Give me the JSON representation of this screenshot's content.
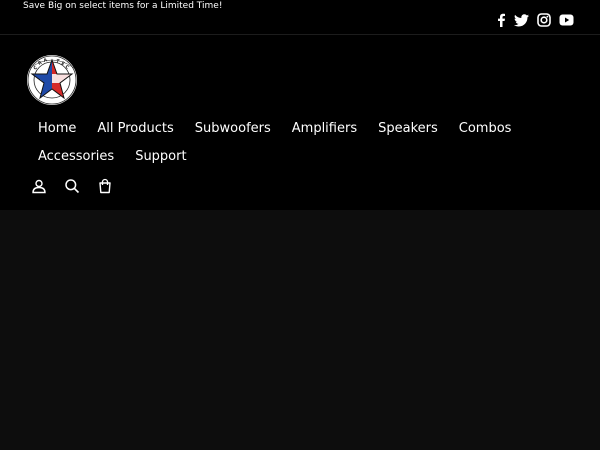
{
  "announcement": {
    "text": "Save Big on select items for a Limited Time!"
  },
  "social": {
    "items": [
      {
        "name": "facebook",
        "icon": "facebook-icon"
      },
      {
        "name": "twitter",
        "icon": "twitter-icon"
      },
      {
        "name": "instagram",
        "icon": "instagram-icon"
      },
      {
        "name": "youtube",
        "icon": "youtube-icon"
      }
    ]
  },
  "logo": {
    "ring_text": "CRA VE TECH"
  },
  "nav": {
    "items": [
      {
        "label": "Home"
      },
      {
        "label": "All Products"
      },
      {
        "label": "Subwoofers"
      },
      {
        "label": "Amplifiers"
      },
      {
        "label": "Speakers"
      },
      {
        "label": "Combos"
      },
      {
        "label": "Accessories"
      },
      {
        "label": "Support"
      }
    ]
  },
  "header_icons": [
    {
      "name": "account",
      "icon": "user-icon"
    },
    {
      "name": "search",
      "icon": "search-icon"
    },
    {
      "name": "cart",
      "icon": "cart-icon"
    }
  ],
  "colors": {
    "announcement_bg": "#000000",
    "header_bg": "#000000",
    "page_bg": "#0d0d0d",
    "logo_blue": "#1f4aa8",
    "logo_red": "#d62828"
  }
}
